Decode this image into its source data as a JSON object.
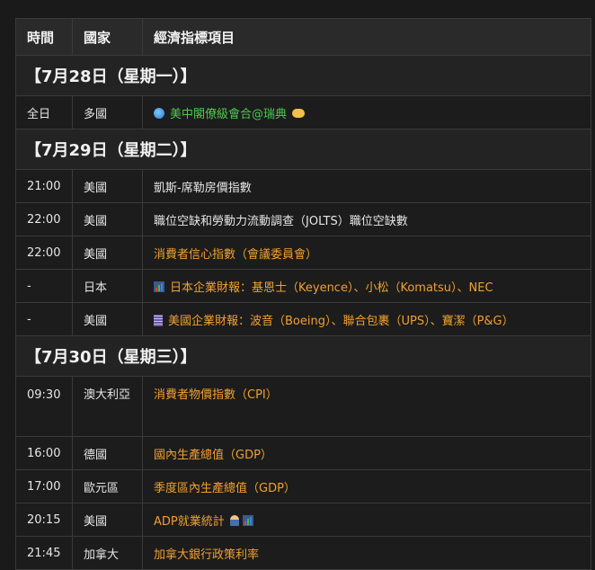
{
  "table": {
    "headers": [
      "時間",
      "國家",
      "經濟指標項目"
    ],
    "groups": [
      {
        "date": "【7月28日（星期一）】",
        "rows": [
          {
            "time": "全日",
            "country": "多國",
            "item": "美中閣僚級會合@瑞典",
            "color": "green",
            "icon_before": "globe-icon",
            "icon_after": "handshake-icon"
          }
        ]
      },
      {
        "date": "【7月29日（星期二）】",
        "rows": [
          {
            "time": "21:00",
            "country": "美國",
            "item": "凱斯-席勒房價指數",
            "color": "white"
          },
          {
            "time": "22:00",
            "country": "美國",
            "item": "職位空缺和勞動力流動調查（JOLTS）職位空缺數",
            "color": "white"
          },
          {
            "time": "22:00",
            "country": "美國",
            "item": "消費者信心指數（會議委員會）",
            "color": "orange"
          },
          {
            "time": "-",
            "country": "日本",
            "item": "日本企業財報：基恩士（Keyence）、小松（Komatsu）、NEC",
            "color": "orange",
            "icon_before": "chart-icon"
          },
          {
            "time": "-",
            "country": "美國",
            "item": "美國企業財報：波音（Boeing）、聯合包裹（UPS）、寶潔（P&G）",
            "color": "orange",
            "icon_before": "building-icon"
          }
        ]
      },
      {
        "date": "【7月30日（星期三）】",
        "rows": [
          {
            "time": "09:30",
            "country": "澳大利亞",
            "item": "消費者物價指數（CPI）",
            "color": "orange"
          },
          {
            "time": "16:00",
            "country": "德國",
            "item": "國內生產總值（GDP）",
            "color": "orange"
          },
          {
            "time": "17:00",
            "country": "歐元區",
            "item": "季度區內生產總值（GDP）",
            "color": "orange"
          },
          {
            "time": "20:15",
            "country": "美國",
            "item": "ADP就業統計",
            "color": "orange",
            "icon_after": "person-icon",
            "icon_after2": "chart-icon"
          },
          {
            "time": "21:45",
            "country": "加拿大",
            "item": "加拿大銀行政策利率",
            "color": "orange"
          }
        ]
      }
    ]
  },
  "colors": {
    "background": "#1a1a1a",
    "orange": "#f0a030",
    "green": "#4ec94e",
    "border": "#3a3a3a"
  }
}
